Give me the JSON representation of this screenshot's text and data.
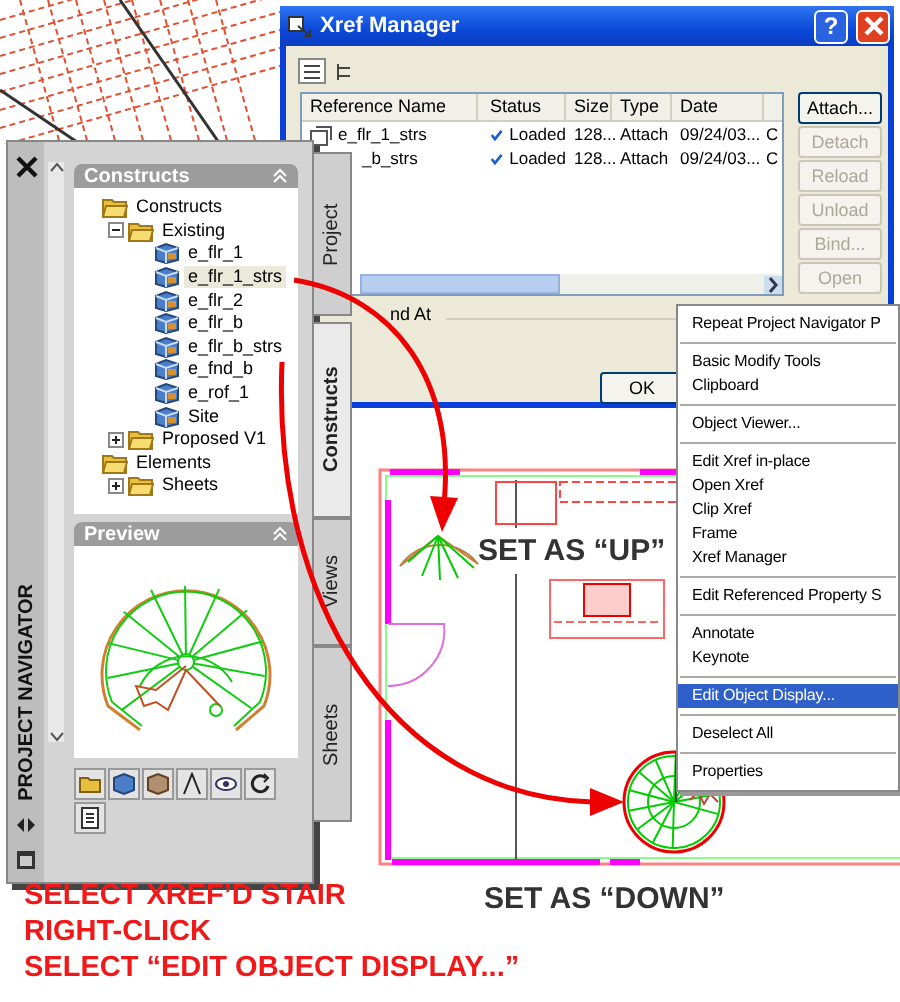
{
  "xref_manager": {
    "title": "Xref Manager",
    "help_button": "?",
    "columns": [
      "Reference Name",
      "Status",
      "Size",
      "Type",
      "Date"
    ],
    "rows": [
      {
        "name": "e_flr_1_strs",
        "status": "Loaded",
        "size": "128...",
        "type": "Attach",
        "date": "09/24/03...",
        "column_6": "C"
      },
      {
        "name": "_b_strs",
        "status": "Loaded",
        "size": "128...",
        "type": "Attach",
        "date": "09/24/03...",
        "column_6": "C"
      }
    ],
    "buttons": [
      {
        "label": "Attach...",
        "disabled": false
      },
      {
        "label": "Detach",
        "disabled": true
      },
      {
        "label": "Reload",
        "disabled": true
      },
      {
        "label": "Unload",
        "disabled": true
      },
      {
        "label": "Bind...",
        "disabled": true
      },
      {
        "label": "Open",
        "disabled": true
      }
    ],
    "found_at_label": "nd At",
    "ok_button": "OK"
  },
  "project_navigator": {
    "title": "PROJECT NAVIGATOR",
    "tabs": [
      {
        "label": "Project",
        "selected": false
      },
      {
        "label": "Constructs",
        "selected": true
      },
      {
        "label": "Views",
        "selected": false
      },
      {
        "label": "Sheets",
        "selected": false
      }
    ],
    "constructs_panel": {
      "title": "Constructs",
      "tree": [
        {
          "label": "Constructs",
          "kind": "folder",
          "children": [
            {
              "label": "Existing",
              "kind": "folder",
              "expanded": true,
              "children": [
                {
                  "label": "e_flr_1",
                  "kind": "construct",
                  "selected": false
                },
                {
                  "label": "e_flr_1_strs",
                  "kind": "construct",
                  "selected": true
                },
                {
                  "label": "e_flr_2",
                  "kind": "construct",
                  "selected": false
                },
                {
                  "label": "e_flr_b",
                  "kind": "construct",
                  "selected": false
                },
                {
                  "label": "e_flr_b_strs",
                  "kind": "construct",
                  "selected": false
                },
                {
                  "label": "e_fnd_b",
                  "kind": "construct",
                  "selected": false
                },
                {
                  "label": "e_rof_1",
                  "kind": "construct",
                  "selected": false
                },
                {
                  "label": "Site",
                  "kind": "construct",
                  "selected": false
                }
              ]
            },
            {
              "label": "Proposed V1",
              "kind": "folder",
              "expanded": false
            }
          ]
        },
        {
          "label": "Elements",
          "kind": "folder",
          "children": [
            {
              "label": "Sheets",
              "kind": "folder",
              "expanded": false
            }
          ]
        }
      ]
    },
    "preview_panel": {
      "title": "Preview"
    }
  },
  "context_menu": {
    "groups": [
      [
        {
          "label": "Repeat Project Navigator P",
          "selected": false
        }
      ],
      [
        {
          "label": "Basic Modify Tools",
          "selected": false
        },
        {
          "label": "Clipboard",
          "selected": false
        }
      ],
      [
        {
          "label": "Object Viewer...",
          "selected": false
        }
      ],
      [
        {
          "label": "Edit Xref in-place",
          "selected": false
        },
        {
          "label": "Open Xref",
          "selected": false
        },
        {
          "label": "Clip Xref",
          "selected": false
        },
        {
          "label": "Frame",
          "selected": false
        },
        {
          "label": "Xref Manager",
          "selected": false
        }
      ],
      [
        {
          "label": "Edit Referenced Property S",
          "selected": false
        }
      ],
      [
        {
          "label": "Annotate",
          "selected": false
        },
        {
          "label": "Keynote",
          "selected": false
        }
      ],
      [
        {
          "label": "Edit Object Display...",
          "selected": true
        }
      ],
      [
        {
          "label": "Deselect All",
          "selected": false
        }
      ],
      [
        {
          "label": "Properties",
          "selected": false
        }
      ]
    ]
  },
  "annotations": {
    "up_label": "SET AS “UP”",
    "down_label": "SET AS “DOWN”",
    "instructions": [
      "SELECT XREF’D STAIR",
      "RIGHT-CLICK",
      "SELECT “EDIT OBJECT DISPLAY...”"
    ]
  }
}
